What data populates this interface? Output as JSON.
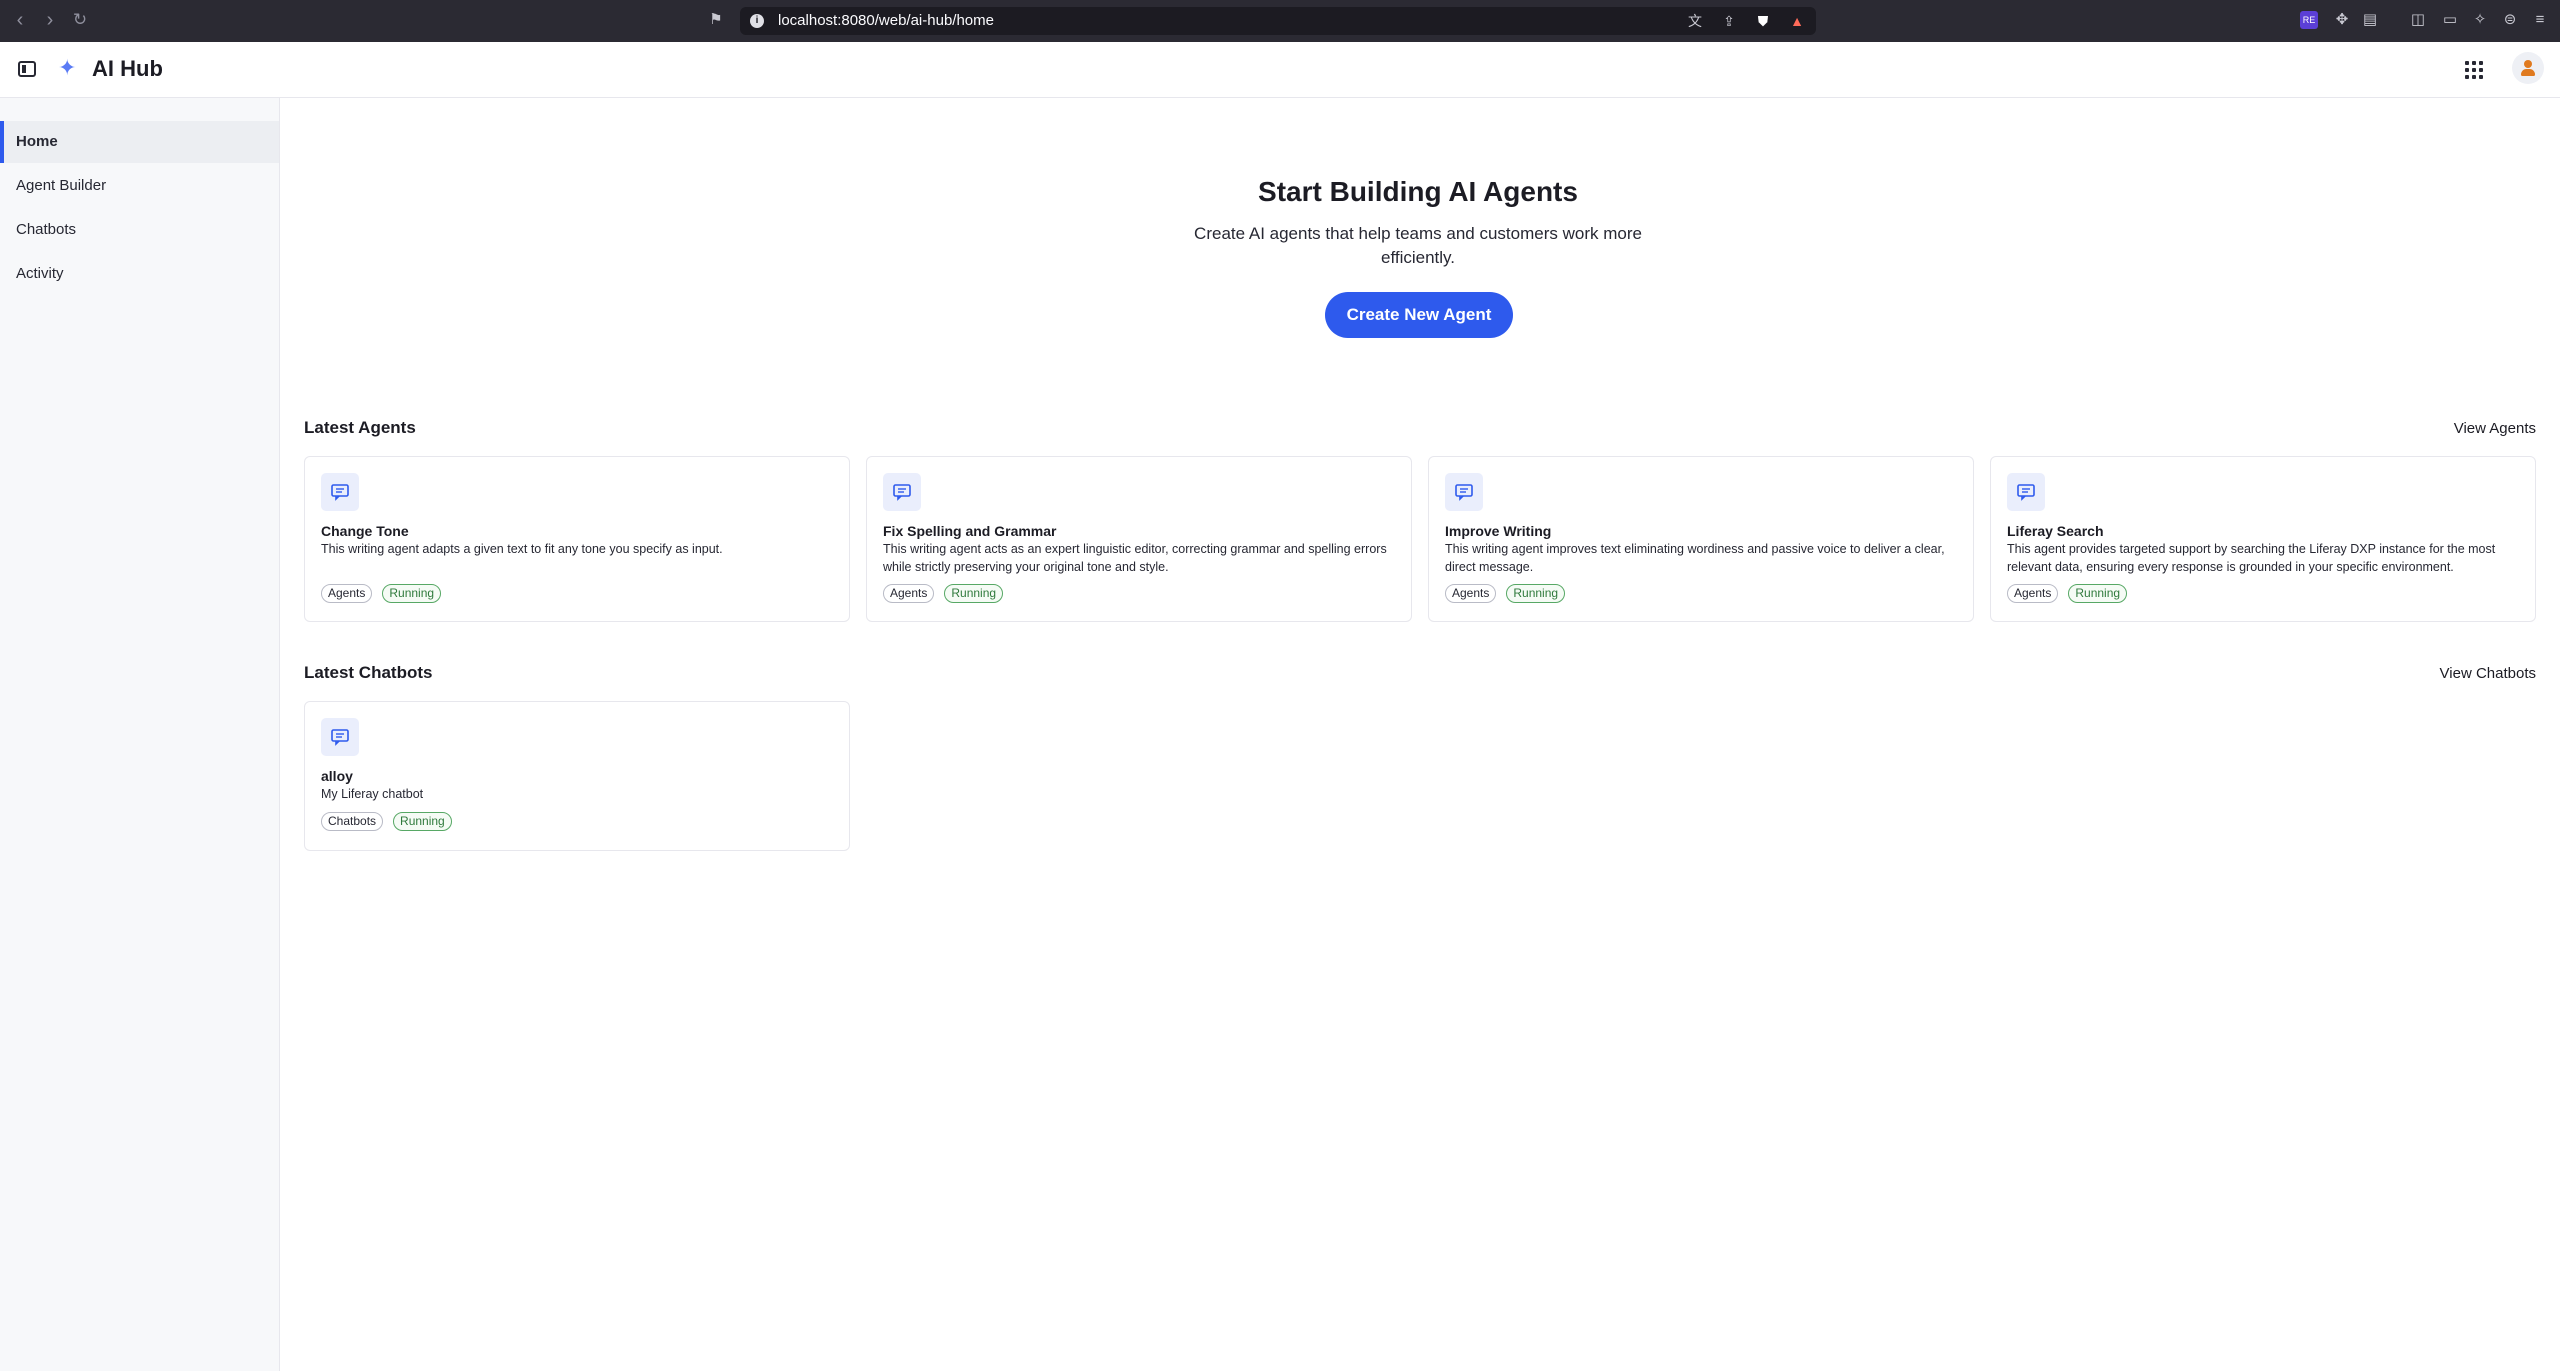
{
  "browser": {
    "url": "localhost:8080/web/ai-hub/home",
    "extension_badge": "RE"
  },
  "header": {
    "title": "AI Hub"
  },
  "sidebar": {
    "items": [
      {
        "label": "Home"
      },
      {
        "label": "Agent Builder"
      },
      {
        "label": "Chatbots"
      },
      {
        "label": "Activity"
      }
    ]
  },
  "hero": {
    "title": "Start Building AI Agents",
    "subtitle": "Create AI agents that help teams and customers work more efficiently.",
    "button_label": "Create New Agent"
  },
  "latest_agents": {
    "title": "Latest Agents",
    "link": "View Agents",
    "cards": [
      {
        "title": "Change Tone",
        "description": "This writing agent adapts a given text to fit any tone you specify as input.",
        "tags": [
          "Agents",
          "Running"
        ]
      },
      {
        "title": "Fix Spelling and Grammar",
        "description": "This writing agent acts as an expert linguistic editor, correcting grammar and spelling errors while strictly preserving your original tone and style.",
        "tags": [
          "Agents",
          "Running"
        ]
      },
      {
        "title": "Improve Writing",
        "description": "This writing agent improves text eliminating wordiness and passive voice to deliver a clear, direct message.",
        "tags": [
          "Agents",
          "Running"
        ]
      },
      {
        "title": "Liferay Search",
        "description": "This agent provides targeted support by searching the Liferay DXP instance for the most relevant data, ensuring every response is grounded in your specific environment.",
        "tags": [
          "Agents",
          "Running"
        ]
      }
    ]
  },
  "latest_chatbots": {
    "title": "Latest Chatbots",
    "link": "View Chatbots",
    "cards": [
      {
        "title": "alloy",
        "description": "My Liferay chatbot",
        "tags": [
          "Chatbots",
          "Running"
        ]
      }
    ]
  },
  "colors": {
    "primary": "#2e5aed",
    "running": "#57a865",
    "sidebar_bg": "#f7f8fa"
  }
}
